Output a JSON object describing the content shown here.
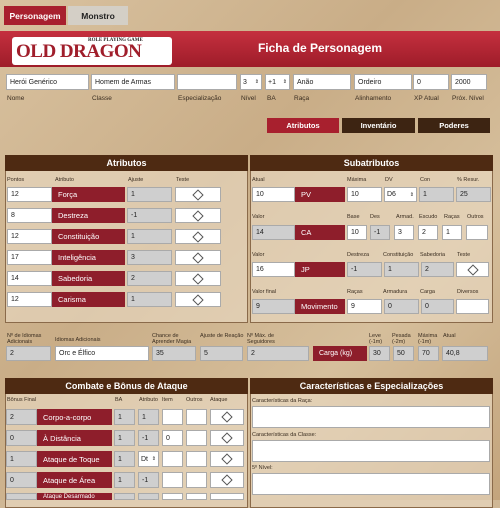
{
  "tabs": {
    "personagem": "Personagem",
    "monstro": "Monstro"
  },
  "header": {
    "title": "Ficha de Personagem",
    "logo_text": "OLD DRAGON",
    "logo_sub": "ROLE PLAYING GAME"
  },
  "basic": {
    "name": "Herói Genérico",
    "class": "Homem de Armas",
    "specialization": "",
    "level": "3",
    "ba": "+1",
    "race": "Anão",
    "alignment": "Ordeiro",
    "xp": "0",
    "next_level": "2000",
    "labels": {
      "name": "Nome",
      "class": "Classe",
      "specialization": "Especialização",
      "level": "Nível",
      "ba": "BA",
      "race": "Raça",
      "alignment": "Alinhamento",
      "xp": "XP Atual",
      "next": "Próx. Nível"
    }
  },
  "section_tabs": {
    "atributos": "Atributos",
    "inventario": "Inventário",
    "poderes": "Poderes"
  },
  "attributes": {
    "title": "Atributos",
    "col_pontos": "Pontos",
    "col_atributo": "Atributo",
    "col_ajuste": "Ajuste",
    "col_teste": "Teste",
    "rows": [
      {
        "points": "12",
        "name": "Força",
        "mod": "1"
      },
      {
        "points": "8",
        "name": "Destreza",
        "mod": "-1"
      },
      {
        "points": "12",
        "name": "Constituição",
        "mod": "1"
      },
      {
        "points": "17",
        "name": "Inteligência",
        "mod": "3"
      },
      {
        "points": "14",
        "name": "Sabedoria",
        "mod": "2"
      },
      {
        "points": "12",
        "name": "Carisma",
        "mod": "1"
      }
    ]
  },
  "subattributes": {
    "title": "Subatributos",
    "pv": {
      "label_atual": "Atual",
      "label_max": "Máxima",
      "label_dv": "DV",
      "label_con": "Con",
      "label_resur": "% Resur.",
      "atual": "10",
      "name": "PV",
      "max": "10",
      "dv": "D6",
      "con": "1",
      "resur": "25"
    },
    "ca": {
      "label_valor": "Valor",
      "labels": [
        "Base",
        "Des",
        "Armad.",
        "Escudo",
        "Raças",
        "Outros"
      ],
      "valor": "14",
      "name": "CA",
      "vals": [
        "10",
        "-1",
        "3",
        "2",
        "1",
        ""
      ]
    },
    "jp": {
      "label_valor": "Valor",
      "labels": [
        "Destreza",
        "Constituição",
        "Sabedoria",
        "Teste"
      ],
      "valor": "16",
      "name": "JP",
      "vals": [
        "-1",
        "1",
        "2"
      ]
    },
    "mov": {
      "label_valor": "Valor final",
      "labels": [
        "Raças",
        "Armadura",
        "Carga",
        "Diversos"
      ],
      "valor": "9",
      "name": "Movimento",
      "vals": [
        "9",
        "0",
        "0",
        ""
      ]
    }
  },
  "misc": {
    "idiomas_label": "Nº de Idiomas Adicionais",
    "idiomas": "2",
    "idiomas_add_label": "Idiomas Adicionais",
    "idiomas_add": "Orc e Élfico",
    "chance_label": "Chance de Aprender Magia",
    "chance": "35",
    "ajuste_label": "Ajuste de Reação",
    "ajuste": "5",
    "seguidores_label": "Nº Máx. de Seguidores",
    "seguidores": "2",
    "carga_label": "Carga (kg)",
    "leve_label": "Leve (-1m)",
    "pesada_label": "Pesada (-2m)",
    "maxima_label": "Máxima (-1m)",
    "atual_label": "Atual",
    "leve": "30",
    "pesada": "50",
    "maxima": "70",
    "atual": "40,8"
  },
  "combat": {
    "title": "Combate e Bônus de Ataque",
    "col_bonus": "Bônus Final",
    "col_ba": "BA",
    "col_atributo": "Atributo",
    "col_item": "Item",
    "col_outros": "Outros",
    "col_ataque": "Ataque",
    "rows": [
      {
        "bonus": "2",
        "name": "Corpo-a-corpo",
        "ba": "1",
        "atributo": "1",
        "item": "",
        "outros": "",
        "sel": false
      },
      {
        "bonus": "0",
        "name": "À Distância",
        "ba": "1",
        "atributo": "-1",
        "item": "0",
        "outros": "",
        "sel": false
      },
      {
        "bonus": "1",
        "name": "Ataque de Toque",
        "ba": "1",
        "atributo": "Dt",
        "item": "",
        "outros": "",
        "sel": true
      },
      {
        "bonus": "0",
        "name": "Ataque de Área",
        "ba": "1",
        "atributo": "-1",
        "item": "",
        "outros": "",
        "sel": false
      },
      {
        "bonus": "",
        "name": "Ataque Desarmado",
        "ba": "",
        "atributo": "",
        "item": "",
        "outros": "",
        "sel": false
      }
    ]
  },
  "features": {
    "title": "Características e Especializações",
    "raca_label": "Características da Raça:",
    "classe_label": "Características da Classe:",
    "nivel_label": "5º Nível:"
  }
}
